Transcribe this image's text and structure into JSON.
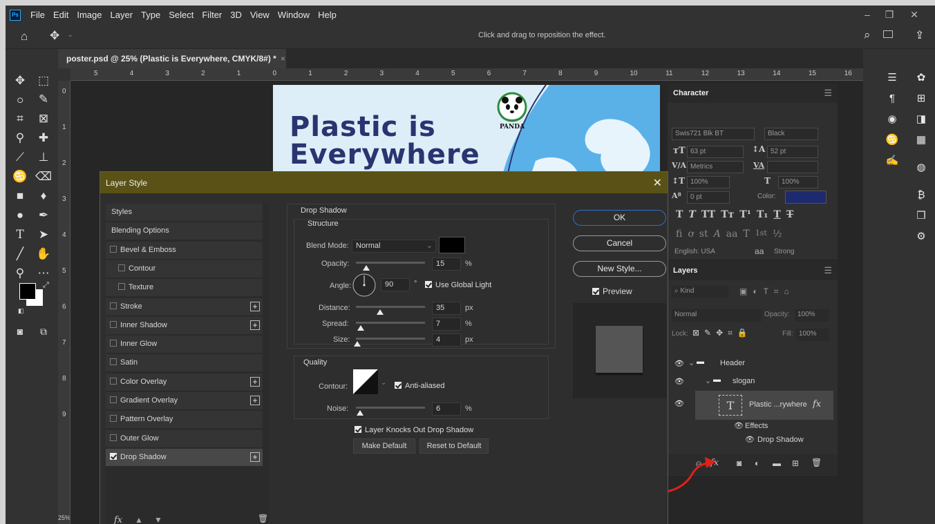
{
  "app": {
    "logo": "Ps",
    "menu": [
      "File",
      "Edit",
      "Image",
      "Layer",
      "Type",
      "Select",
      "Filter",
      "3D",
      "View",
      "Window",
      "Help"
    ]
  },
  "options": {
    "hint": "Click and drag to reposition the effect."
  },
  "document": {
    "tab_title": "poster.psd @ 25% (Plastic is Everywhere, CMYK/8#) *",
    "zoom": "25%",
    "ruler_h": [
      "5",
      "4",
      "3",
      "2",
      "1",
      "0",
      "1",
      "2",
      "3",
      "4",
      "5",
      "6",
      "7",
      "8",
      "9",
      "10",
      "11",
      "12",
      "13",
      "14",
      "15",
      "16"
    ],
    "ruler_v": [
      "0",
      "1",
      "2",
      "3",
      "4",
      "5",
      "6",
      "7",
      "8",
      "9"
    ]
  },
  "poster": {
    "line1": "Plastic is",
    "line2": "Everywhere",
    "logo_text": "PANDA"
  },
  "character": {
    "title": "Character",
    "font_family": "Swis721 Blk BT",
    "font_style": "Black",
    "size": "63 pt",
    "leading": "52 pt",
    "kerning": "Metrics",
    "vscale": "100%",
    "hscale": "100%",
    "baseline": "0 pt",
    "color_label": "Color:",
    "color": "#1e2a6e",
    "language": "English: USA",
    "aa_prefix": "a",
    "aa": "Strong",
    "type_buttons": [
      "T",
      "T",
      "TT",
      "Tт",
      "T¹",
      "T₁",
      "T",
      "T"
    ],
    "ot_buttons": [
      "fi",
      "ơ",
      "st",
      "A",
      "aa",
      "T",
      "1st",
      "½"
    ]
  },
  "layers": {
    "title": "Layers",
    "kind": "Kind",
    "blend": "Normal",
    "opacity_label": "Opacity:",
    "opacity": "100%",
    "lock_label": "Lock:",
    "fill_label": "Fill:",
    "fill": "100%",
    "rows": [
      {
        "name": "Header"
      },
      {
        "name": "slogan"
      },
      {
        "name": "Plastic ...rywhere",
        "fx": "fx"
      },
      {
        "name": "Effects"
      },
      {
        "name": "Drop Shadow"
      }
    ],
    "footer_fx": "fx"
  },
  "dialog": {
    "title": "Layer Style",
    "styles": [
      {
        "label": "Styles",
        "check": false,
        "has_check": false,
        "plus": false,
        "indent": false
      },
      {
        "label": "Blending Options",
        "check": false,
        "has_check": false,
        "plus": false,
        "indent": false
      },
      {
        "label": "Bevel & Emboss",
        "check": false,
        "has_check": true,
        "plus": false,
        "indent": false
      },
      {
        "label": "Contour",
        "check": false,
        "has_check": true,
        "plus": false,
        "indent": true
      },
      {
        "label": "Texture",
        "check": false,
        "has_check": true,
        "plus": false,
        "indent": true
      },
      {
        "label": "Stroke",
        "check": false,
        "has_check": true,
        "plus": true,
        "indent": false
      },
      {
        "label": "Inner Shadow",
        "check": false,
        "has_check": true,
        "plus": true,
        "indent": false
      },
      {
        "label": "Inner Glow",
        "check": false,
        "has_check": true,
        "plus": false,
        "indent": false
      },
      {
        "label": "Satin",
        "check": false,
        "has_check": true,
        "plus": false,
        "indent": false
      },
      {
        "label": "Color Overlay",
        "check": false,
        "has_check": true,
        "plus": true,
        "indent": false
      },
      {
        "label": "Gradient Overlay",
        "check": false,
        "has_check": true,
        "plus": true,
        "indent": false
      },
      {
        "label": "Pattern Overlay",
        "check": false,
        "has_check": true,
        "plus": false,
        "indent": false
      },
      {
        "label": "Outer Glow",
        "check": false,
        "has_check": true,
        "plus": false,
        "indent": false
      },
      {
        "label": "Drop Shadow",
        "check": true,
        "has_check": true,
        "plus": true,
        "indent": false
      }
    ],
    "list_footer_fx": "fx",
    "section_title": "Drop Shadow",
    "structure": "Structure",
    "blend_mode_label": "Blend Mode:",
    "blend_mode": "Normal",
    "shadow_color": "#000000",
    "opacity_label": "Opacity:",
    "opacity": "15",
    "opacity_pct": 15,
    "angle_label": "Angle:",
    "angle": "90",
    "deg": "°",
    "use_global_light": "Use Global Light",
    "distance_label": "Distance:",
    "distance": "35",
    "distance_pct": 35,
    "spread_label": "Spread:",
    "spread": "7",
    "spread_pct": 7,
    "size_label": "Size:",
    "size": "4",
    "size_pct": 2,
    "unit_pct": "%",
    "unit_px": "px",
    "quality": "Quality",
    "contour_label": "Contour:",
    "anti_aliased": "Anti-aliased",
    "noise_label": "Noise:",
    "noise": "6",
    "noise_pct": 6,
    "knocks_out": "Layer Knocks Out Drop Shadow",
    "make_default": "Make Default",
    "reset_default": "Reset to Default",
    "ok": "OK",
    "cancel": "Cancel",
    "new_style": "New Style...",
    "preview": "Preview"
  },
  "colors": {
    "accent": "#2f6fcf",
    "dialog_title_bar": "#5a5116",
    "annotation_arrow": "#e0201a"
  }
}
